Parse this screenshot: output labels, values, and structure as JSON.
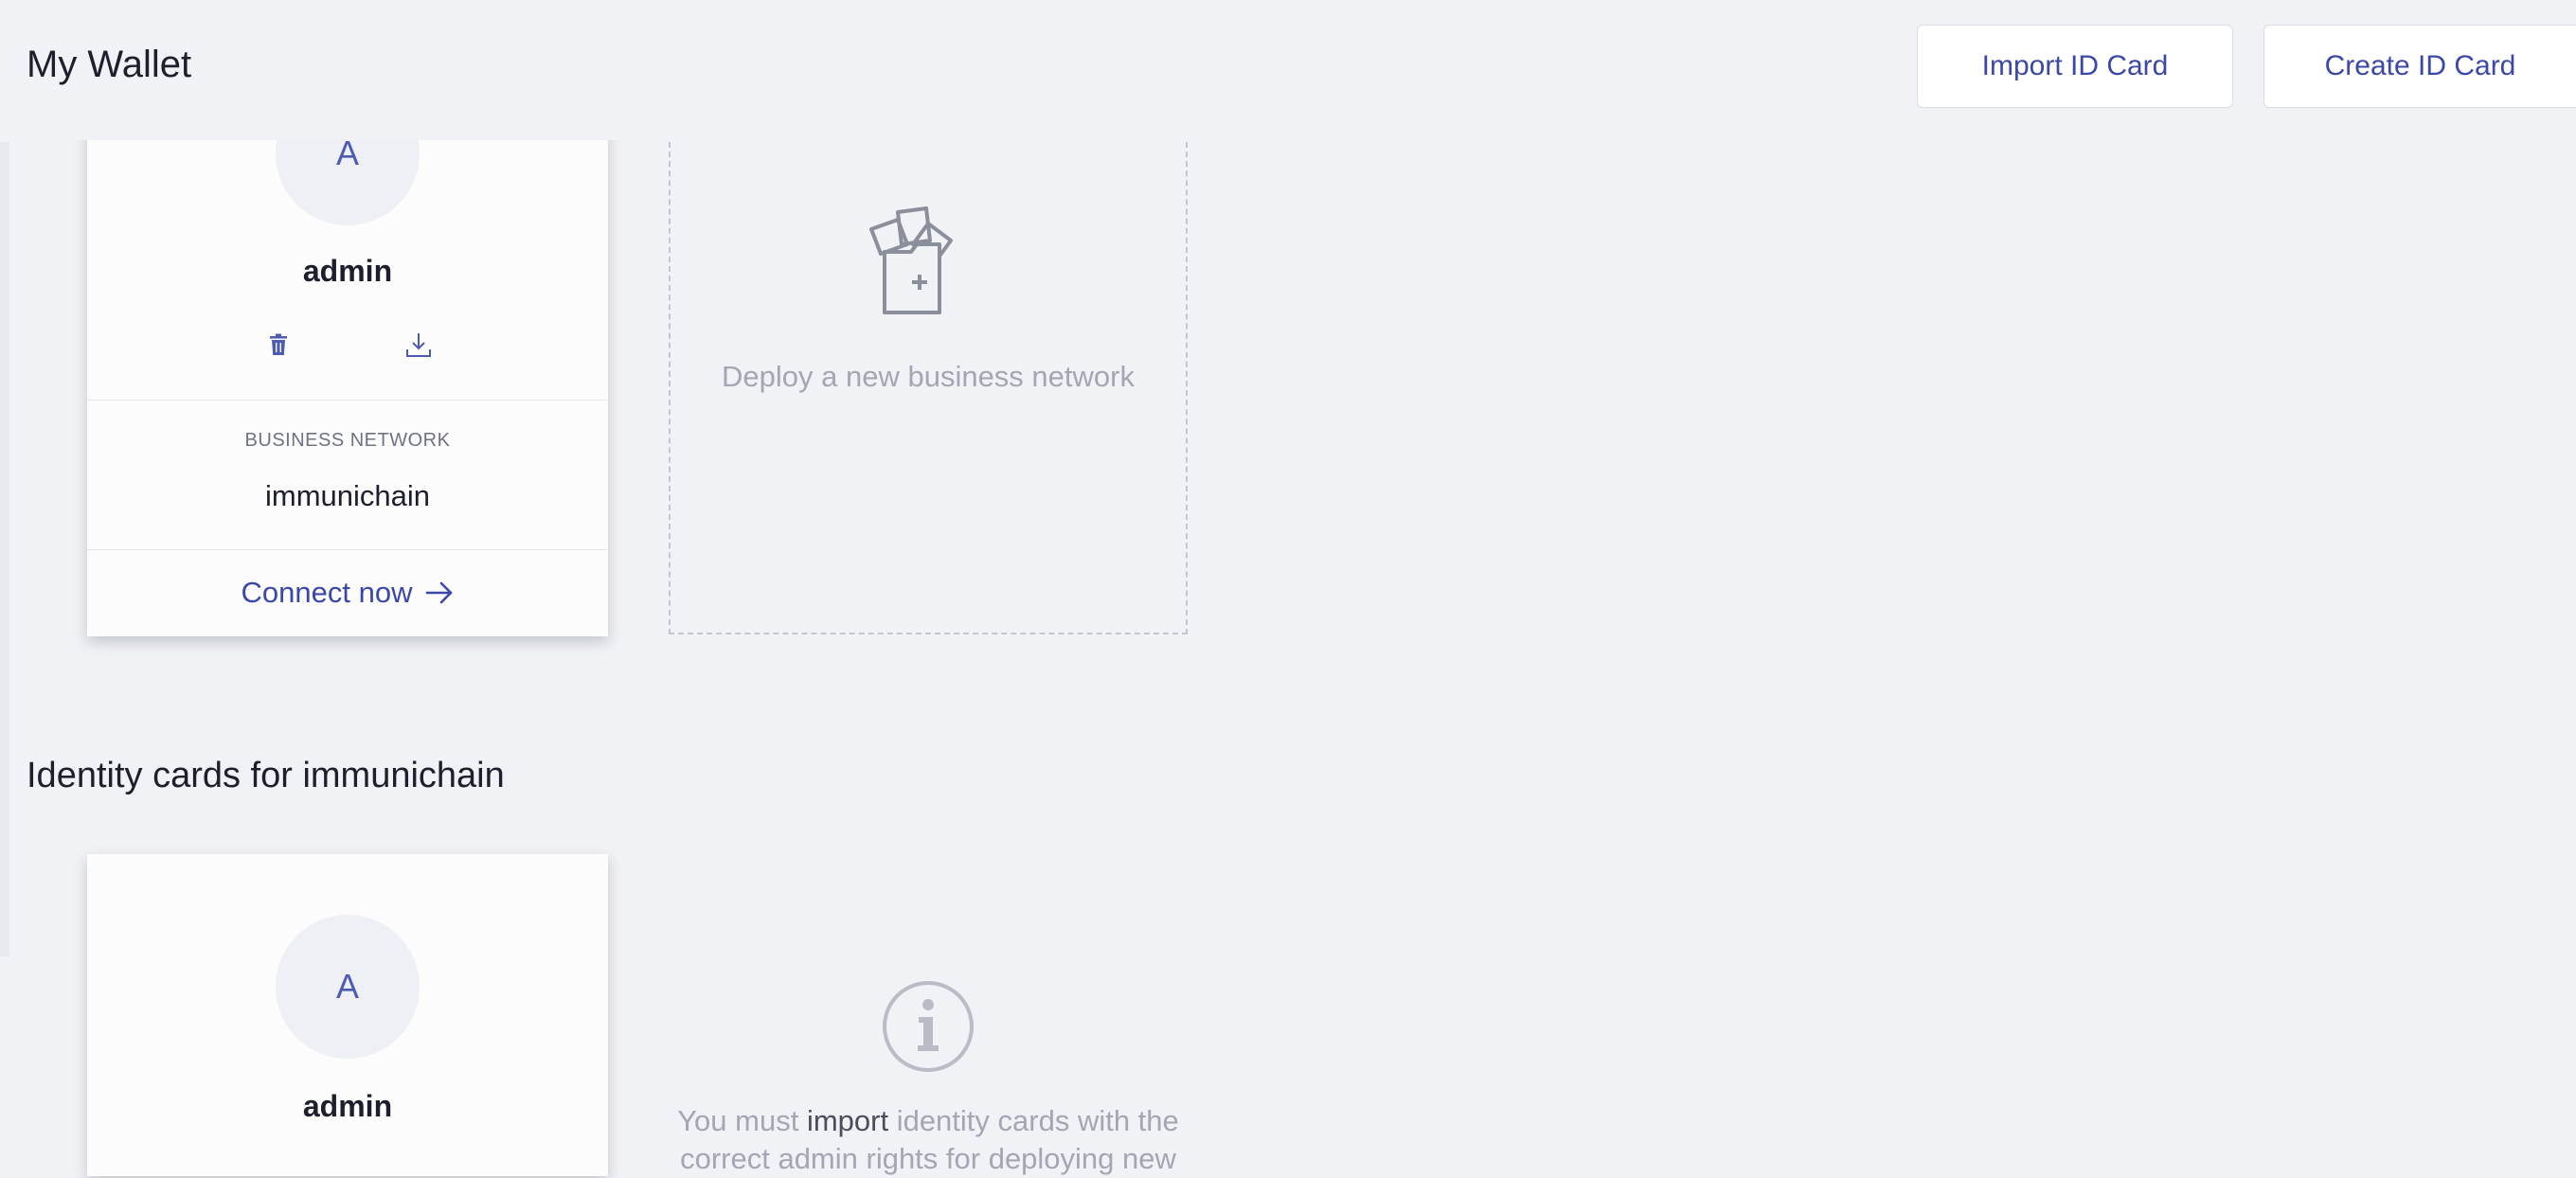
{
  "header": {
    "title": "My Wallet",
    "import_label": "Import ID Card",
    "create_label": "Create ID Card"
  },
  "wallet_card": {
    "avatar_letter": "A",
    "user_name": "admin",
    "network_label": "BUSINESS NETWORK",
    "network_name": "immunichain",
    "connect_label": "Connect now",
    "icons": [
      "trash-icon",
      "download-icon",
      "arrow-right-icon"
    ]
  },
  "deploy": {
    "label": "Deploy a new business network",
    "icon": "folder-add-icon"
  },
  "identity_section": {
    "title": "Identity cards for immunichain",
    "card": {
      "avatar_letter": "A",
      "user_name": "admin"
    },
    "info": {
      "prefix": "You must ",
      "emphasis": "import",
      "suffix": " identity cards with the correct admin rights for deploying new",
      "icon": "info-icon"
    }
  },
  "colors": {
    "accent": "#3b48a7",
    "background": "#f1f2f6",
    "muted_text": "#a3a6b3"
  }
}
